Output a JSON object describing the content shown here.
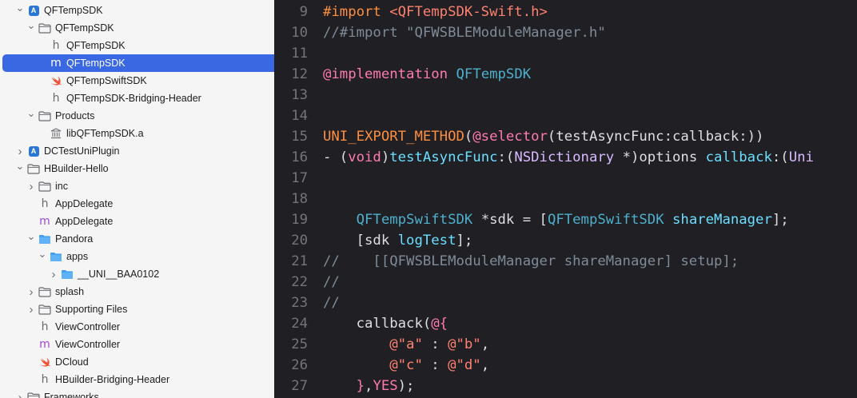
{
  "navigator": {
    "items": [
      {
        "label": "QFTempSDK",
        "icon": "xcode-project-icon",
        "chevron": "down",
        "indent": 0,
        "selected": false
      },
      {
        "label": "QFTempSDK",
        "icon": "folder-icon",
        "chevron": "down",
        "indent": 1,
        "selected": false
      },
      {
        "label": "QFTempSDK",
        "icon": "header-file-icon",
        "chevron": "none",
        "indent": 2,
        "selected": false
      },
      {
        "label": "QFTempSDK",
        "icon": "objc-file-icon",
        "chevron": "none",
        "indent": 2,
        "selected": true
      },
      {
        "label": "QFTempSwiftSDK",
        "icon": "swift-file-icon",
        "chevron": "none",
        "indent": 2,
        "selected": false
      },
      {
        "label": "QFTempSDK-Bridging-Header",
        "icon": "header-file-icon",
        "chevron": "none",
        "indent": 2,
        "selected": false
      },
      {
        "label": "Products",
        "icon": "folder-icon",
        "chevron": "down",
        "indent": 1,
        "selected": false
      },
      {
        "label": "libQFTempSDK.a",
        "icon": "library-icon",
        "chevron": "none",
        "indent": 2,
        "selected": false
      },
      {
        "label": "DCTestUniPlugin",
        "icon": "xcode-project-icon",
        "chevron": "right",
        "indent": 0,
        "selected": false
      },
      {
        "label": "HBuilder-Hello",
        "icon": "folder-icon",
        "chevron": "down",
        "indent": 0,
        "selected": false
      },
      {
        "label": "inc",
        "icon": "folder-icon",
        "chevron": "right",
        "indent": 1,
        "selected": false
      },
      {
        "label": "AppDelegate",
        "icon": "header-file-icon",
        "chevron": "none",
        "indent": 1,
        "selected": false
      },
      {
        "label": "AppDelegate",
        "icon": "objc-file-icon",
        "chevron": "none",
        "indent": 1,
        "selected": false
      },
      {
        "label": "Pandora",
        "icon": "blue-folder-icon",
        "chevron": "down",
        "indent": 1,
        "selected": false
      },
      {
        "label": "apps",
        "icon": "blue-folder-icon",
        "chevron": "down",
        "indent": 2,
        "selected": false
      },
      {
        "label": "__UNI__BAA0102",
        "icon": "blue-folder-icon",
        "chevron": "right",
        "indent": 3,
        "selected": false
      },
      {
        "label": "splash",
        "icon": "folder-icon",
        "chevron": "right",
        "indent": 1,
        "selected": false
      },
      {
        "label": "Supporting Files",
        "icon": "folder-icon",
        "chevron": "right",
        "indent": 1,
        "selected": false
      },
      {
        "label": "ViewController",
        "icon": "header-file-icon",
        "chevron": "none",
        "indent": 1,
        "selected": false
      },
      {
        "label": "ViewController",
        "icon": "objc-file-icon",
        "chevron": "none",
        "indent": 1,
        "selected": false
      },
      {
        "label": "DCloud",
        "icon": "swift-file-icon",
        "chevron": "none",
        "indent": 1,
        "selected": false
      },
      {
        "label": "HBuilder-Bridging-Header",
        "icon": "header-file-icon",
        "chevron": "none",
        "indent": 1,
        "selected": false
      },
      {
        "label": "Frameworks",
        "icon": "folder-icon",
        "chevron": "right",
        "indent": 0,
        "selected": false
      }
    ]
  },
  "editor": {
    "lines": [
      {
        "num": "9",
        "tokens": [
          [
            "prep",
            "#import "
          ],
          [
            "str",
            "<QFTempSDK-Swift.h>"
          ]
        ]
      },
      {
        "num": "10",
        "tokens": [
          [
            "cmt",
            "//#import \"QFWSBLEModuleManager.h\""
          ]
        ]
      },
      {
        "num": "11",
        "tokens": []
      },
      {
        "num": "12",
        "tokens": [
          [
            "kw",
            "@implementation"
          ],
          [
            "punc",
            " "
          ],
          [
            "cls",
            "QFTempSDK"
          ]
        ]
      },
      {
        "num": "13",
        "tokens": []
      },
      {
        "num": "14",
        "tokens": []
      },
      {
        "num": "15",
        "tokens": [
          [
            "prep",
            "UNI_EXPORT_METHOD"
          ],
          [
            "punc",
            "("
          ],
          [
            "kw",
            "@selector"
          ],
          [
            "punc",
            "(testAsyncFunc:callback:))"
          ]
        ]
      },
      {
        "num": "16",
        "tokens": [
          [
            "punc",
            "- ("
          ],
          [
            "kw",
            "void"
          ],
          [
            "punc",
            ")"
          ],
          [
            "fn",
            "testAsyncFunc"
          ],
          [
            "punc",
            ":("
          ],
          [
            "sys",
            "NSDictionary"
          ],
          [
            "punc",
            " *)options "
          ],
          [
            "fn",
            "callback"
          ],
          [
            "punc",
            ":("
          ],
          [
            "sys",
            "Uni"
          ]
        ]
      },
      {
        "num": "17",
        "tokens": []
      },
      {
        "num": "18",
        "tokens": []
      },
      {
        "num": "19",
        "tokens": [
          [
            "punc",
            "    "
          ],
          [
            "cls",
            "QFTempSwiftSDK"
          ],
          [
            "punc",
            " *sdk = ["
          ],
          [
            "cls",
            "QFTempSwiftSDK"
          ],
          [
            "punc",
            " "
          ],
          [
            "fn",
            "shareManager"
          ],
          [
            "punc",
            "];"
          ]
        ]
      },
      {
        "num": "20",
        "tokens": [
          [
            "punc",
            "    [sdk "
          ],
          [
            "fn",
            "logTest"
          ],
          [
            "punc",
            "];"
          ]
        ]
      },
      {
        "num": "21",
        "tokens": [
          [
            "cmt",
            "//    [[QFWSBLEModuleManager shareManager] setup];"
          ]
        ]
      },
      {
        "num": "22",
        "tokens": [
          [
            "cmt",
            "//"
          ]
        ]
      },
      {
        "num": "23",
        "tokens": [
          [
            "cmt",
            "//"
          ]
        ]
      },
      {
        "num": "24",
        "tokens": [
          [
            "punc",
            "    callback("
          ],
          [
            "at",
            "@{"
          ]
        ]
      },
      {
        "num": "25",
        "tokens": [
          [
            "punc",
            "        "
          ],
          [
            "str",
            "@\"a\""
          ],
          [
            "punc",
            " : "
          ],
          [
            "str",
            "@\"b\""
          ],
          [
            "punc",
            ","
          ]
        ]
      },
      {
        "num": "26",
        "tokens": [
          [
            "punc",
            "        "
          ],
          [
            "str",
            "@\"c\""
          ],
          [
            "punc",
            " : "
          ],
          [
            "str",
            "@\"d\""
          ],
          [
            "punc",
            ","
          ]
        ]
      },
      {
        "num": "27",
        "tokens": [
          [
            "punc",
            "    "
          ],
          [
            "at",
            "}"
          ],
          [
            "punc",
            ","
          ],
          [
            "yes",
            "YES"
          ],
          [
            "punc",
            ");"
          ]
        ]
      }
    ]
  }
}
